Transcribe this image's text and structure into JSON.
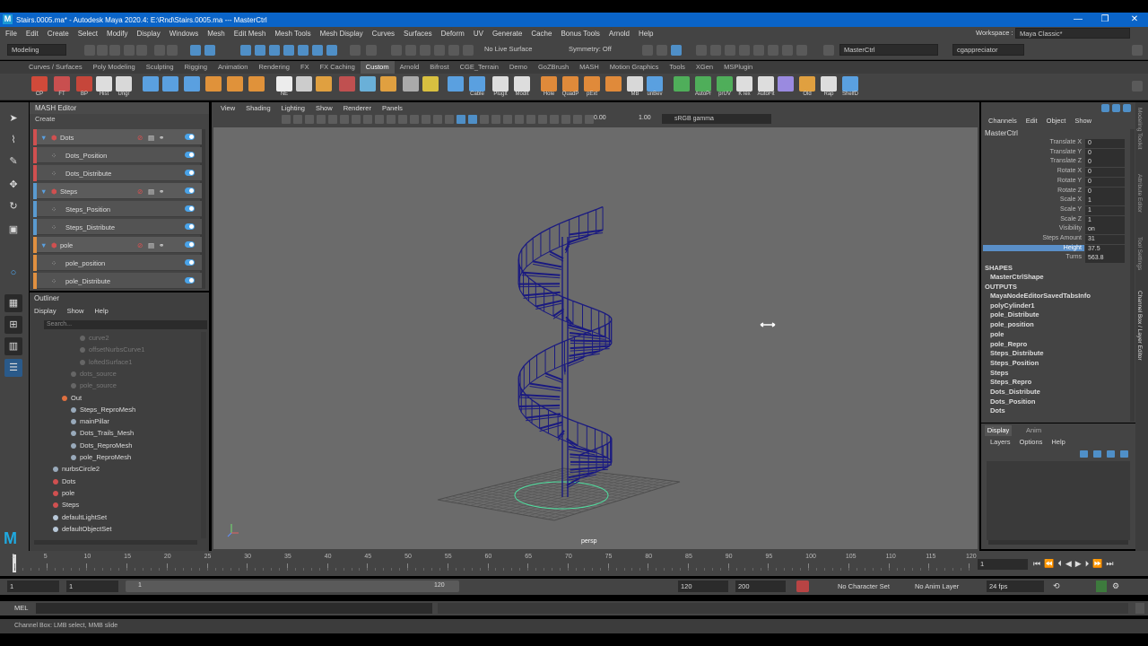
{
  "titlebar": {
    "title": "Stairs.0005.ma* - Autodesk Maya 2020.4: E:\\Rnd\\Stairs.0005.ma --- MasterCtrl",
    "logo": "M",
    "minimize_icon": "—",
    "restore_icon": "❐",
    "close_icon": "✕"
  },
  "menus": [
    "File",
    "Edit",
    "Create",
    "Select",
    "Modify",
    "Display",
    "Windows",
    "Mesh",
    "Edit Mesh",
    "Mesh Tools",
    "Mesh Display",
    "Curves",
    "Surfaces",
    "Deform",
    "UV",
    "Generate",
    "Cache",
    "Bonus Tools",
    "Arnold",
    "Help"
  ],
  "workspace": {
    "label": "Workspace :",
    "value": "Maya Classic*"
  },
  "statusline": {
    "mode": "Modeling",
    "live_surface": "No Live Surface",
    "symmetry": "Symmetry: Off",
    "object_field": "MasterCtrl",
    "user": "cgappreciator"
  },
  "shelf_tabs": [
    "Curves / Surfaces",
    "Poly Modeling",
    "Sculpting",
    "Rigging",
    "Animation",
    "Rendering",
    "FX",
    "FX Caching",
    "Custom",
    "Arnold",
    "Bifrost",
    "CGE_Terrain",
    "Demo",
    "GoZBrush",
    "MASH",
    "Motion Graphics",
    "Tools",
    "XGen",
    "MSPlugin"
  ],
  "shelf_active": "Custom",
  "shelf_items": [
    {
      "label": "CP",
      "color": "#d04a3a"
    },
    {
      "label": "FT",
      "color": "#c94f4f"
    },
    {
      "label": "BP",
      "color": "#c6463a"
    },
    {
      "label": "Hist",
      "color": "#dddddd"
    },
    {
      "label": "Ungr",
      "color": "#d8d8d8"
    },
    {
      "label": "",
      "color": "#5aa0e0"
    },
    {
      "label": "",
      "color": "#5aa0e0"
    },
    {
      "label": "",
      "color": "#5aa0e0"
    },
    {
      "label": "",
      "color": "#e0923a"
    },
    {
      "label": "",
      "color": "#e0923a"
    },
    {
      "label": "",
      "color": "#e0923a"
    },
    {
      "label": "NE",
      "color": "#ececec"
    },
    {
      "label": "",
      "color": "#cccccc"
    },
    {
      "label": "",
      "color": "#e0a040"
    },
    {
      "label": "",
      "color": "#c05050"
    },
    {
      "label": "",
      "color": "#6ab0d8"
    },
    {
      "label": "",
      "color": "#e0a040"
    },
    {
      "label": "",
      "color": "#aaaaaa"
    },
    {
      "label": "",
      "color": "#d8c040"
    },
    {
      "label": "",
      "color": "#5aa0e0"
    },
    {
      "label": "Cable",
      "color": "#5aa0e0"
    },
    {
      "label": "PlugIt",
      "color": "#dddddd"
    },
    {
      "label": "ModIt",
      "color": "#dddddd"
    },
    {
      "label": "Hole",
      "color": "#e08a3a"
    },
    {
      "label": "QuadP",
      "color": "#e08a3a"
    },
    {
      "label": "pExt",
      "color": "#e08a3a"
    },
    {
      "label": "",
      "color": "#e08a3a"
    },
    {
      "label": "MB",
      "color": "#d8d8d8"
    },
    {
      "label": "unBev",
      "color": "#5aa0e0"
    },
    {
      "label": "",
      "color": "#4fae5a"
    },
    {
      "label": "AutoPr",
      "color": "#4fae5a"
    },
    {
      "label": "prUV",
      "color": "#4fae5a"
    },
    {
      "label": "KTex",
      "color": "#dddddd"
    },
    {
      "label": "AutoFit",
      "color": "#dddddd"
    },
    {
      "label": "",
      "color": "#9a8ae0"
    },
    {
      "label": "Old",
      "color": "#e0a040"
    },
    {
      "label": "Rap",
      "color": "#dddddd"
    },
    {
      "label": "ShelfD",
      "color": "#5aa0e0"
    }
  ],
  "mash_editor": {
    "title": "MASH Editor",
    "create": "Create",
    "rows": [
      {
        "label": "Dots",
        "group": true,
        "color": "#d05050"
      },
      {
        "label": "Dots_Position",
        "group": false,
        "color": "#d05050"
      },
      {
        "label": "Dots_Distribute",
        "group": false,
        "color": "#d05050"
      },
      {
        "label": "Steps",
        "group": true,
        "color": "#5a9ad0"
      },
      {
        "label": "Steps_Position",
        "group": false,
        "color": "#5a9ad0"
      },
      {
        "label": "Steps_Distribute",
        "group": false,
        "color": "#5a9ad0"
      },
      {
        "label": "pole",
        "group": true,
        "color": "#e09040"
      },
      {
        "label": "pole_position",
        "group": false,
        "color": "#e09040"
      },
      {
        "label": "pole_Distribute",
        "group": false,
        "color": "#e09040"
      }
    ]
  },
  "outliner": {
    "title": "Outliner",
    "menu": [
      "Display",
      "Show",
      "Help"
    ],
    "search_placeholder": "Search...",
    "items": [
      {
        "label": "curve2",
        "indent": 3,
        "dim": true
      },
      {
        "label": "offsetNurbsCurve1",
        "indent": 3,
        "dim": true
      },
      {
        "label": "loftedSurface1",
        "indent": 3,
        "dim": true
      },
      {
        "label": "dots_source",
        "indent": 2,
        "dim": true
      },
      {
        "label": "pole_source",
        "indent": 2,
        "dim": true
      },
      {
        "label": "Out",
        "indent": 1,
        "dim": false
      },
      {
        "label": "Steps_ReproMesh",
        "indent": 2,
        "dim": false
      },
      {
        "label": "mainPillar",
        "indent": 2,
        "dim": false
      },
      {
        "label": "Dots_Trails_Mesh",
        "indent": 2,
        "dim": false
      },
      {
        "label": "Dots_ReproMesh",
        "indent": 2,
        "dim": false
      },
      {
        "label": "pole_ReproMesh",
        "indent": 2,
        "dim": false
      },
      {
        "label": "nurbsCircle2",
        "indent": 0,
        "dim": false
      },
      {
        "label": "Dots",
        "indent": 0,
        "dim": false
      },
      {
        "label": "pole",
        "indent": 0,
        "dim": false
      },
      {
        "label": "Steps",
        "indent": 0,
        "dim": false
      },
      {
        "label": "defaultLightSet",
        "indent": 0,
        "dim": false
      },
      {
        "label": "defaultObjectSet",
        "indent": 0,
        "dim": false
      }
    ]
  },
  "viewport": {
    "menu": [
      "View",
      "Shading",
      "Lighting",
      "Show",
      "Renderer",
      "Panels"
    ],
    "near": "0.00",
    "far": "1.00",
    "colorspace": "sRGB gamma",
    "camera_label": "persp"
  },
  "channelbox": {
    "menu": [
      "Channels",
      "Edit",
      "Object",
      "Show"
    ],
    "node": "MasterCtrl",
    "attrs": [
      {
        "k": "Translate X",
        "v": "0"
      },
      {
        "k": "Translate Y",
        "v": "0"
      },
      {
        "k": "Translate Z",
        "v": "0"
      },
      {
        "k": "Rotate X",
        "v": "0"
      },
      {
        "k": "Rotate Y",
        "v": "0"
      },
      {
        "k": "Rotate Z",
        "v": "0"
      },
      {
        "k": "Scale X",
        "v": "1"
      },
      {
        "k": "Scale Y",
        "v": "1"
      },
      {
        "k": "Scale Z",
        "v": "1"
      },
      {
        "k": "Visibility",
        "v": "on"
      },
      {
        "k": "Steps Amount",
        "v": "31"
      },
      {
        "k": "Height",
        "v": "37.5"
      },
      {
        "k": "Turns",
        "v": "563.8"
      }
    ],
    "highlighted": "Height",
    "shapes_header": "SHAPES",
    "shapes": [
      "MasterCtrlShape"
    ],
    "outputs_header": "OUTPUTS",
    "outputs": [
      "MayaNodeEditorSavedTabsInfo",
      "polyCylinder1",
      "pole_Distribute",
      "pole_position",
      "pole",
      "pole_Repro",
      "Steps_Distribute",
      "Steps_Position",
      "Steps",
      "Steps_Repro",
      "Dots_Distribute",
      "Dots_Position",
      "Dots"
    ]
  },
  "layer_editor": {
    "tabs": [
      "Display",
      "Anim"
    ],
    "menu": [
      "Layers",
      "Options",
      "Help"
    ]
  },
  "sidetabs": [
    "Modeling Toolkit",
    "Attribute Editor",
    "Tool Settings",
    "Channel Box / Layer Editor"
  ],
  "timeline": {
    "ticks": [
      "1",
      "5",
      "10",
      "15",
      "20",
      "25",
      "30",
      "35",
      "40",
      "45",
      "50",
      "55",
      "60",
      "65",
      "70",
      "75",
      "80",
      "85",
      "90",
      "95",
      "100",
      "105",
      "110",
      "115",
      "120"
    ],
    "current_frame": "1"
  },
  "range": {
    "start": "1",
    "playback_start": "1",
    "slider_start": "1",
    "slider_end": "120",
    "playback_end": "120",
    "end": "200",
    "character_set": "No Character Set",
    "anim_layer": "No Anim Layer",
    "fps": "24 fps"
  },
  "mel": {
    "label": "MEL"
  },
  "help_line": "Channel Box: LMB select, MMB slide"
}
